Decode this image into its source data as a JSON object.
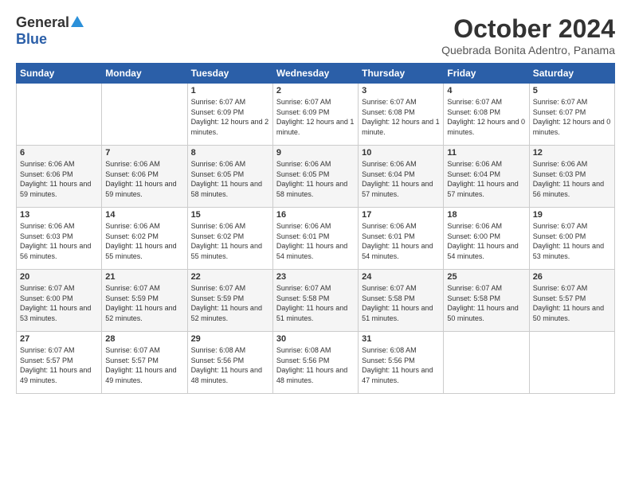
{
  "logo": {
    "general": "General",
    "blue": "Blue"
  },
  "header": {
    "month": "October 2024",
    "location": "Quebrada Bonita Adentro, Panama"
  },
  "weekdays": [
    "Sunday",
    "Monday",
    "Tuesday",
    "Wednesday",
    "Thursday",
    "Friday",
    "Saturday"
  ],
  "weeks": [
    [
      {
        "day": "",
        "sunrise": "",
        "sunset": "",
        "daylight": ""
      },
      {
        "day": "",
        "sunrise": "",
        "sunset": "",
        "daylight": ""
      },
      {
        "day": "1",
        "sunrise": "Sunrise: 6:07 AM",
        "sunset": "Sunset: 6:09 PM",
        "daylight": "Daylight: 12 hours and 2 minutes."
      },
      {
        "day": "2",
        "sunrise": "Sunrise: 6:07 AM",
        "sunset": "Sunset: 6:09 PM",
        "daylight": "Daylight: 12 hours and 1 minute."
      },
      {
        "day": "3",
        "sunrise": "Sunrise: 6:07 AM",
        "sunset": "Sunset: 6:08 PM",
        "daylight": "Daylight: 12 hours and 1 minute."
      },
      {
        "day": "4",
        "sunrise": "Sunrise: 6:07 AM",
        "sunset": "Sunset: 6:08 PM",
        "daylight": "Daylight: 12 hours and 0 minutes."
      },
      {
        "day": "5",
        "sunrise": "Sunrise: 6:07 AM",
        "sunset": "Sunset: 6:07 PM",
        "daylight": "Daylight: 12 hours and 0 minutes."
      }
    ],
    [
      {
        "day": "6",
        "sunrise": "Sunrise: 6:06 AM",
        "sunset": "Sunset: 6:06 PM",
        "daylight": "Daylight: 11 hours and 59 minutes."
      },
      {
        "day": "7",
        "sunrise": "Sunrise: 6:06 AM",
        "sunset": "Sunset: 6:06 PM",
        "daylight": "Daylight: 11 hours and 59 minutes."
      },
      {
        "day": "8",
        "sunrise": "Sunrise: 6:06 AM",
        "sunset": "Sunset: 6:05 PM",
        "daylight": "Daylight: 11 hours and 58 minutes."
      },
      {
        "day": "9",
        "sunrise": "Sunrise: 6:06 AM",
        "sunset": "Sunset: 6:05 PM",
        "daylight": "Daylight: 11 hours and 58 minutes."
      },
      {
        "day": "10",
        "sunrise": "Sunrise: 6:06 AM",
        "sunset": "Sunset: 6:04 PM",
        "daylight": "Daylight: 11 hours and 57 minutes."
      },
      {
        "day": "11",
        "sunrise": "Sunrise: 6:06 AM",
        "sunset": "Sunset: 6:04 PM",
        "daylight": "Daylight: 11 hours and 57 minutes."
      },
      {
        "day": "12",
        "sunrise": "Sunrise: 6:06 AM",
        "sunset": "Sunset: 6:03 PM",
        "daylight": "Daylight: 11 hours and 56 minutes."
      }
    ],
    [
      {
        "day": "13",
        "sunrise": "Sunrise: 6:06 AM",
        "sunset": "Sunset: 6:03 PM",
        "daylight": "Daylight: 11 hours and 56 minutes."
      },
      {
        "day": "14",
        "sunrise": "Sunrise: 6:06 AM",
        "sunset": "Sunset: 6:02 PM",
        "daylight": "Daylight: 11 hours and 55 minutes."
      },
      {
        "day": "15",
        "sunrise": "Sunrise: 6:06 AM",
        "sunset": "Sunset: 6:02 PM",
        "daylight": "Daylight: 11 hours and 55 minutes."
      },
      {
        "day": "16",
        "sunrise": "Sunrise: 6:06 AM",
        "sunset": "Sunset: 6:01 PM",
        "daylight": "Daylight: 11 hours and 54 minutes."
      },
      {
        "day": "17",
        "sunrise": "Sunrise: 6:06 AM",
        "sunset": "Sunset: 6:01 PM",
        "daylight": "Daylight: 11 hours and 54 minutes."
      },
      {
        "day": "18",
        "sunrise": "Sunrise: 6:06 AM",
        "sunset": "Sunset: 6:00 PM",
        "daylight": "Daylight: 11 hours and 54 minutes."
      },
      {
        "day": "19",
        "sunrise": "Sunrise: 6:07 AM",
        "sunset": "Sunset: 6:00 PM",
        "daylight": "Daylight: 11 hours and 53 minutes."
      }
    ],
    [
      {
        "day": "20",
        "sunrise": "Sunrise: 6:07 AM",
        "sunset": "Sunset: 6:00 PM",
        "daylight": "Daylight: 11 hours and 53 minutes."
      },
      {
        "day": "21",
        "sunrise": "Sunrise: 6:07 AM",
        "sunset": "Sunset: 5:59 PM",
        "daylight": "Daylight: 11 hours and 52 minutes."
      },
      {
        "day": "22",
        "sunrise": "Sunrise: 6:07 AM",
        "sunset": "Sunset: 5:59 PM",
        "daylight": "Daylight: 11 hours and 52 minutes."
      },
      {
        "day": "23",
        "sunrise": "Sunrise: 6:07 AM",
        "sunset": "Sunset: 5:58 PM",
        "daylight": "Daylight: 11 hours and 51 minutes."
      },
      {
        "day": "24",
        "sunrise": "Sunrise: 6:07 AM",
        "sunset": "Sunset: 5:58 PM",
        "daylight": "Daylight: 11 hours and 51 minutes."
      },
      {
        "day": "25",
        "sunrise": "Sunrise: 6:07 AM",
        "sunset": "Sunset: 5:58 PM",
        "daylight": "Daylight: 11 hours and 50 minutes."
      },
      {
        "day": "26",
        "sunrise": "Sunrise: 6:07 AM",
        "sunset": "Sunset: 5:57 PM",
        "daylight": "Daylight: 11 hours and 50 minutes."
      }
    ],
    [
      {
        "day": "27",
        "sunrise": "Sunrise: 6:07 AM",
        "sunset": "Sunset: 5:57 PM",
        "daylight": "Daylight: 11 hours and 49 minutes."
      },
      {
        "day": "28",
        "sunrise": "Sunrise: 6:07 AM",
        "sunset": "Sunset: 5:57 PM",
        "daylight": "Daylight: 11 hours and 49 minutes."
      },
      {
        "day": "29",
        "sunrise": "Sunrise: 6:08 AM",
        "sunset": "Sunset: 5:56 PM",
        "daylight": "Daylight: 11 hours and 48 minutes."
      },
      {
        "day": "30",
        "sunrise": "Sunrise: 6:08 AM",
        "sunset": "Sunset: 5:56 PM",
        "daylight": "Daylight: 11 hours and 48 minutes."
      },
      {
        "day": "31",
        "sunrise": "Sunrise: 6:08 AM",
        "sunset": "Sunset: 5:56 PM",
        "daylight": "Daylight: 11 hours and 47 minutes."
      },
      {
        "day": "",
        "sunrise": "",
        "sunset": "",
        "daylight": ""
      },
      {
        "day": "",
        "sunrise": "",
        "sunset": "",
        "daylight": ""
      }
    ]
  ]
}
